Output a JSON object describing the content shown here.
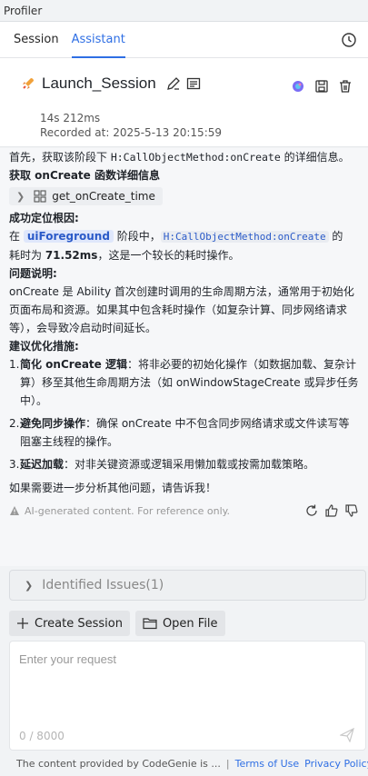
{
  "window": {
    "title": "Profiler"
  },
  "tabs": [
    {
      "label": "Session",
      "active": false
    },
    {
      "label": "Assistant",
      "active": true
    }
  ],
  "session": {
    "title": "Launch_Session",
    "duration": "14s 212ms",
    "recorded": "Recorded at: 2025-5-13 20:15:59"
  },
  "conversation": {
    "intro_prefix": "首先，获取该阶段下 ",
    "intro_code": "H:CallObjectMethod:onCreate",
    "intro_suffix": " 的详细信息。",
    "fetch_heading": "获取 onCreate 函数详细信息",
    "tool_call": "get_onCreate_time",
    "root_heading": "成功定位根因:",
    "root_pre": "在 ",
    "root_tag": "uiForeground",
    "root_mid": " 阶段中，",
    "root_code": "H:CallObjectMethod:onCreate",
    "root_post1": " 的",
    "root_post2": "耗时为 ",
    "root_value": "71.52ms",
    "root_post3": "，这是一个较长的耗时操作。",
    "problem_heading": "问题说明:",
    "problem_text": "onCreate 是 Ability 首次创建时调用的生命周期方法，通常用于初始化页面布局和资源。如果其中包含耗时操作（如复杂计算、同步网络请求等），会导致冷启动时间延长。",
    "advice_heading": "建议优化措施:",
    "steps": [
      {
        "num": "1.",
        "title": "简化 onCreate 逻辑",
        "text": "：将非必要的初始化操作（如数据加载、复杂计算）移至其他生命周期方法（如 onWindowStageCreate 或异步任务中）。"
      },
      {
        "num": "2.",
        "title": "避免同步操作",
        "text": "：确保 onCreate 中不包含同步网络请求或文件读写等阻塞主线程的操作。"
      },
      {
        "num": "3.",
        "title": "延迟加载",
        "text": "：对非关键资源或逻辑采用懒加载或按需加载策略。"
      }
    ],
    "closing": "如果需要进一步分析其他问题，请告诉我！",
    "disclaimer": "AI-generated content. For reference only."
  },
  "issues": {
    "label": "Identified Issues(1)"
  },
  "actions": {
    "create_session": "Create Session",
    "open_file": "Open File"
  },
  "input": {
    "placeholder": "Enter your request",
    "counter": "0 / 8000"
  },
  "footer": {
    "provided_by": "The content provided by CodeGenie is ...",
    "separator": "|",
    "terms": "Terms of Use",
    "privacy": "Privacy Policy"
  },
  "colors": {
    "accent": "#2f6fe4",
    "background": "#f6f7f9"
  }
}
